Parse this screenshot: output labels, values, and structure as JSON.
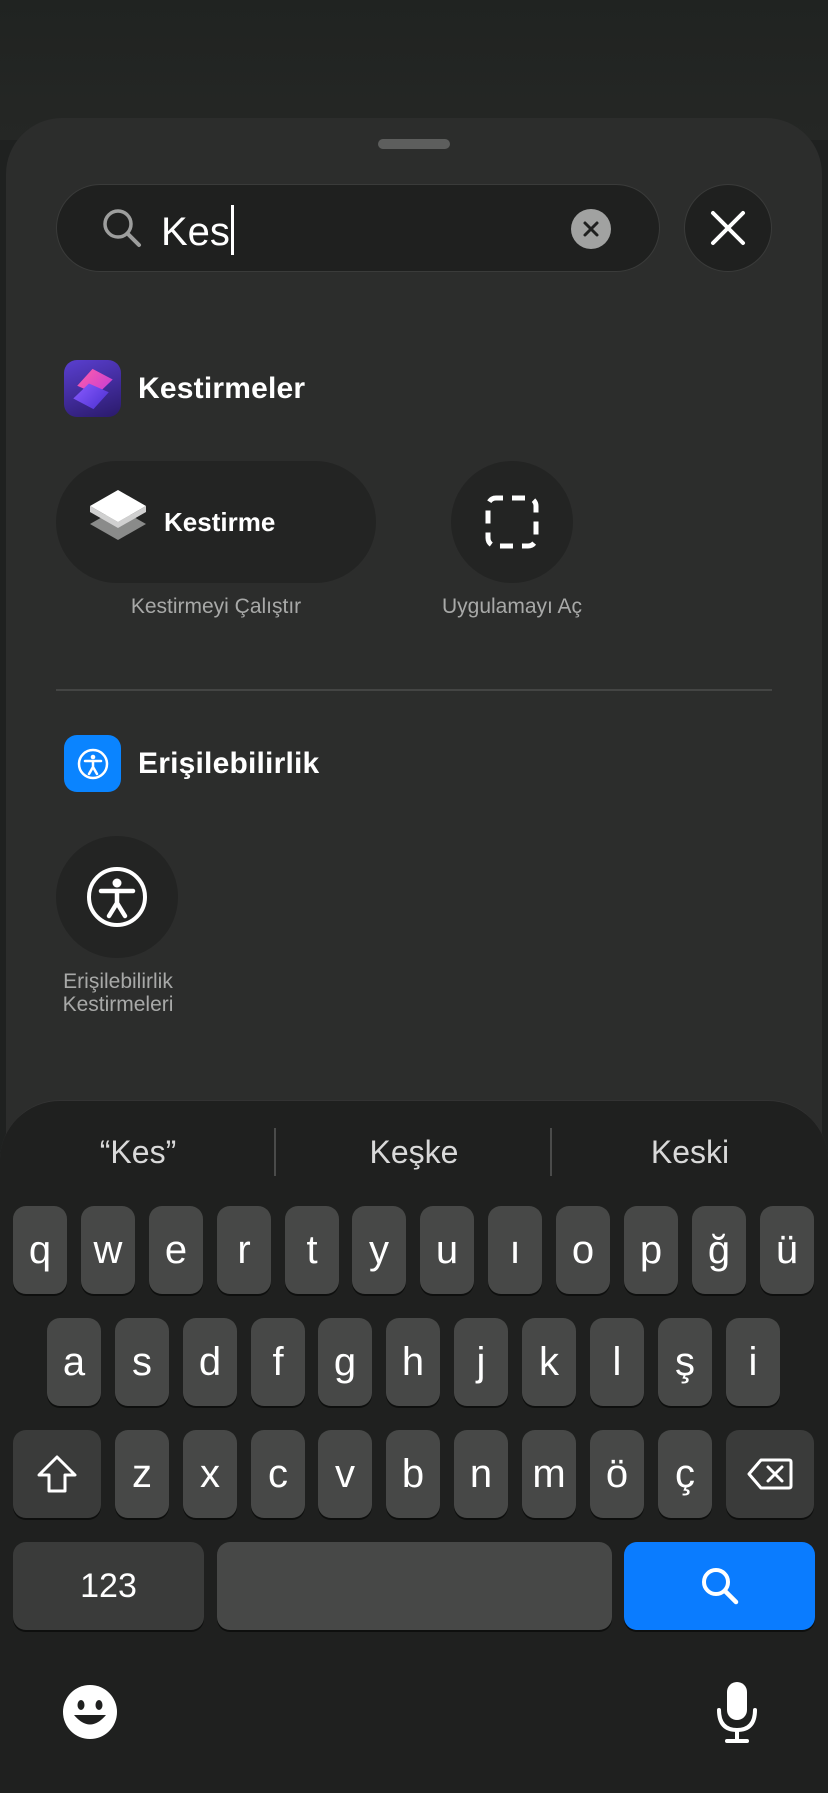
{
  "search": {
    "value": "Kes"
  },
  "sections": [
    {
      "title": "Kestirmeler",
      "items": [
        {
          "label": "Kestirme",
          "caption": "Kestirmeyi Çalıştır"
        },
        {
          "caption": "Uygulamayı Aç"
        }
      ]
    },
    {
      "title": "Erişilebilirlik",
      "items": [
        {
          "caption_line1": "Erişilebilirlik",
          "caption_line2": "Kestirmeleri"
        }
      ]
    }
  ],
  "keyboard": {
    "suggestions": [
      "“Kes”",
      "Keşke",
      "Keski"
    ],
    "row1": [
      "q",
      "w",
      "e",
      "r",
      "t",
      "y",
      "u",
      "ı",
      "o",
      "p",
      "ğ",
      "ü"
    ],
    "row2": [
      "a",
      "s",
      "d",
      "f",
      "g",
      "h",
      "j",
      "k",
      "l",
      "ş",
      "i"
    ],
    "row3": [
      "z",
      "x",
      "c",
      "v",
      "b",
      "n",
      "m",
      "ö",
      "ç"
    ],
    "numbers_label": "123"
  },
  "colors": {
    "accent": "#0a7cff",
    "accessibility_icon": "#0a84ff",
    "shortcuts_icon_gradient": [
      "#e2469a",
      "#5b3bd6"
    ]
  },
  "icons": {
    "search": "magnifier-icon",
    "clear": "clear-x-circle-icon",
    "close": "close-x-icon",
    "shift": "shift-arrow-icon",
    "delete": "delete-backspace-icon",
    "emoji": "emoji-face-icon",
    "dictation": "microphone-icon"
  }
}
